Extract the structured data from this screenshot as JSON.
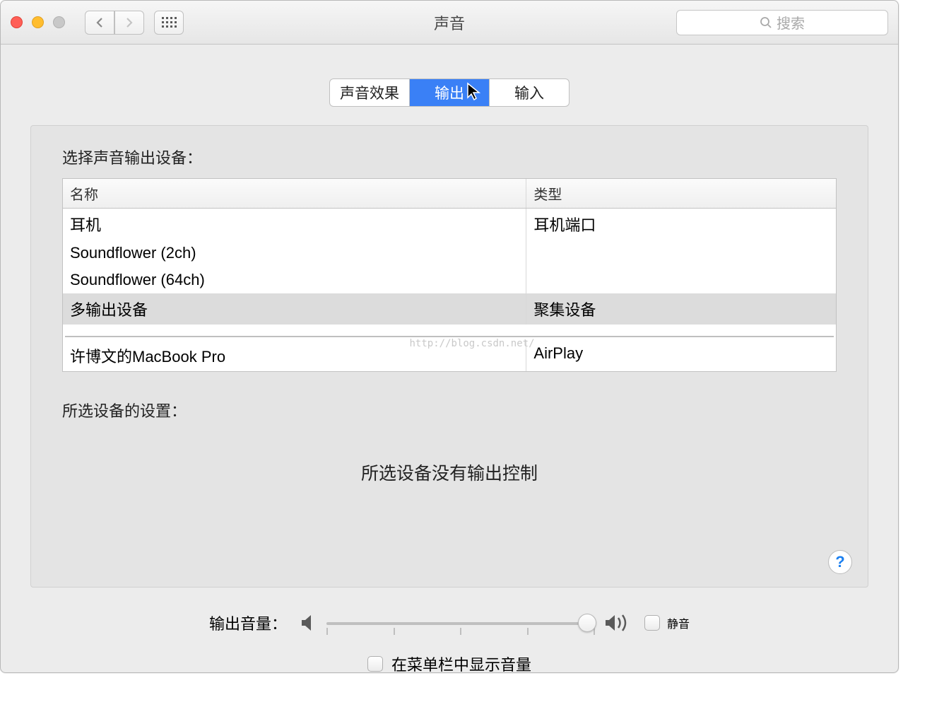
{
  "window_title": "声音",
  "search_placeholder": "搜索",
  "tabs": {
    "effects": "声音效果",
    "output": "输出",
    "input": "输入"
  },
  "section_label": "选择声音输出设备：",
  "columns": {
    "name": "名称",
    "type": "类型"
  },
  "devices": [
    {
      "name": "耳机",
      "type": "耳机端口"
    },
    {
      "name": "Soundflower (2ch)",
      "type": ""
    },
    {
      "name": "Soundflower (64ch)",
      "type": ""
    },
    {
      "name": "多输出设备",
      "type": "聚集设备"
    },
    {
      "name": "许博文的MacBook Pro",
      "type": "AirPlay"
    }
  ],
  "selected_device_index": 3,
  "settings_label": "所选设备的设置：",
  "no_controls_text": "所选设备没有输出控制",
  "volume_label": "输出音量：",
  "mute_label": "静音",
  "menubar_label": "在菜单栏中显示音量",
  "watermark": "http://blog.csdn.net/",
  "help_symbol": "?"
}
